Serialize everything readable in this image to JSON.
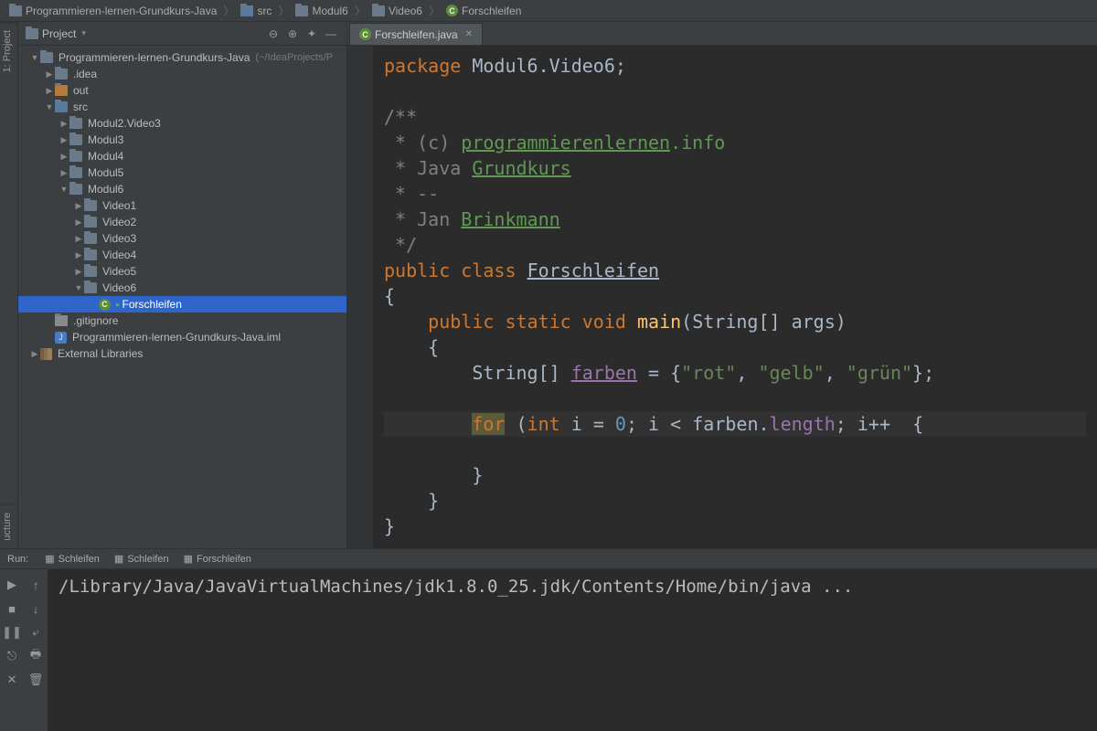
{
  "breadcrumb": [
    {
      "icon": "folder",
      "label": "Programmieren-lernen-Grundkurs-Java"
    },
    {
      "icon": "folder-blue",
      "label": "src"
    },
    {
      "icon": "folder",
      "label": "Modul6"
    },
    {
      "icon": "folder",
      "label": "Video6"
    },
    {
      "icon": "class",
      "label": "Forschleifen"
    }
  ],
  "left_gutter": {
    "tab1": "1: Project",
    "tab2": "ucture"
  },
  "project_tool": {
    "title": "Project",
    "buttons": [
      "collapse",
      "target",
      "gear",
      "hide"
    ]
  },
  "tree": [
    {
      "depth": 0,
      "arrow": "down",
      "icon": "folder",
      "label": "Programmieren-lernen-Grundkurs-Java",
      "dim": "(~/IdeaProjects/P"
    },
    {
      "depth": 1,
      "arrow": "right",
      "icon": "folder",
      "label": ".idea"
    },
    {
      "depth": 1,
      "arrow": "right",
      "icon": "folder-orange",
      "label": "out"
    },
    {
      "depth": 1,
      "arrow": "down",
      "icon": "folder-blue",
      "label": "src"
    },
    {
      "depth": 2,
      "arrow": "right",
      "icon": "folder",
      "label": "Modul2.Video3"
    },
    {
      "depth": 2,
      "arrow": "right",
      "icon": "folder",
      "label": "Modul3"
    },
    {
      "depth": 2,
      "arrow": "right",
      "icon": "folder",
      "label": "Modul4"
    },
    {
      "depth": 2,
      "arrow": "right",
      "icon": "folder",
      "label": "Modul5"
    },
    {
      "depth": 2,
      "arrow": "down",
      "icon": "folder",
      "label": "Modul6"
    },
    {
      "depth": 3,
      "arrow": "right",
      "icon": "folder",
      "label": "Video1"
    },
    {
      "depth": 3,
      "arrow": "right",
      "icon": "folder",
      "label": "Video2"
    },
    {
      "depth": 3,
      "arrow": "right",
      "icon": "folder",
      "label": "Video3"
    },
    {
      "depth": 3,
      "arrow": "right",
      "icon": "folder",
      "label": "Video4"
    },
    {
      "depth": 3,
      "arrow": "right",
      "icon": "folder",
      "label": "Video5"
    },
    {
      "depth": 3,
      "arrow": "down",
      "icon": "folder",
      "label": "Video6"
    },
    {
      "depth": 4,
      "arrow": "",
      "icon": "class",
      "label": "Forschleifen",
      "selected": true,
      "run": true
    },
    {
      "depth": 1,
      "arrow": "",
      "icon": "file",
      "label": ".gitignore"
    },
    {
      "depth": 1,
      "arrow": "",
      "icon": "j",
      "label": "Programmieren-lernen-Grundkurs-Java.iml"
    },
    {
      "depth": 0,
      "arrow": "right",
      "icon": "lib",
      "label": "External Libraries"
    }
  ],
  "editor_tab": "Forschleifen.java",
  "code": {
    "package_kw": "package",
    "package_name": "Modul6.Video6",
    "comment": {
      "l1": "/**",
      "l2a": " * (c) ",
      "l2b": "programmierenlernen",
      "l2c": ".info",
      "l3a": " * Java ",
      "l3b": "Grundkurs",
      "l4": " * --",
      "l5a": " * Jan ",
      "l5b": "Brinkmann",
      "l6": " */"
    },
    "public": "public",
    "class_kw": "class",
    "class_name": "Forschleifen",
    "static": "static",
    "void": "void",
    "main": "main",
    "string": "String",
    "args": "args",
    "farben": "farben",
    "rot": "\"rot\"",
    "gelb": "\"gelb\"",
    "gruen": "\"grün\"",
    "for": "for",
    "int": "int",
    "i": "i",
    "zero": "0",
    "length": "length",
    "ipp": "i++"
  },
  "run": {
    "title": "Run:",
    "tabs": [
      "Schleifen",
      "Schleifen",
      "Forschleifen"
    ],
    "console": "/Library/Java/JavaVirtualMachines/jdk1.8.0_25.jdk/Contents/Home/bin/java ..."
  }
}
